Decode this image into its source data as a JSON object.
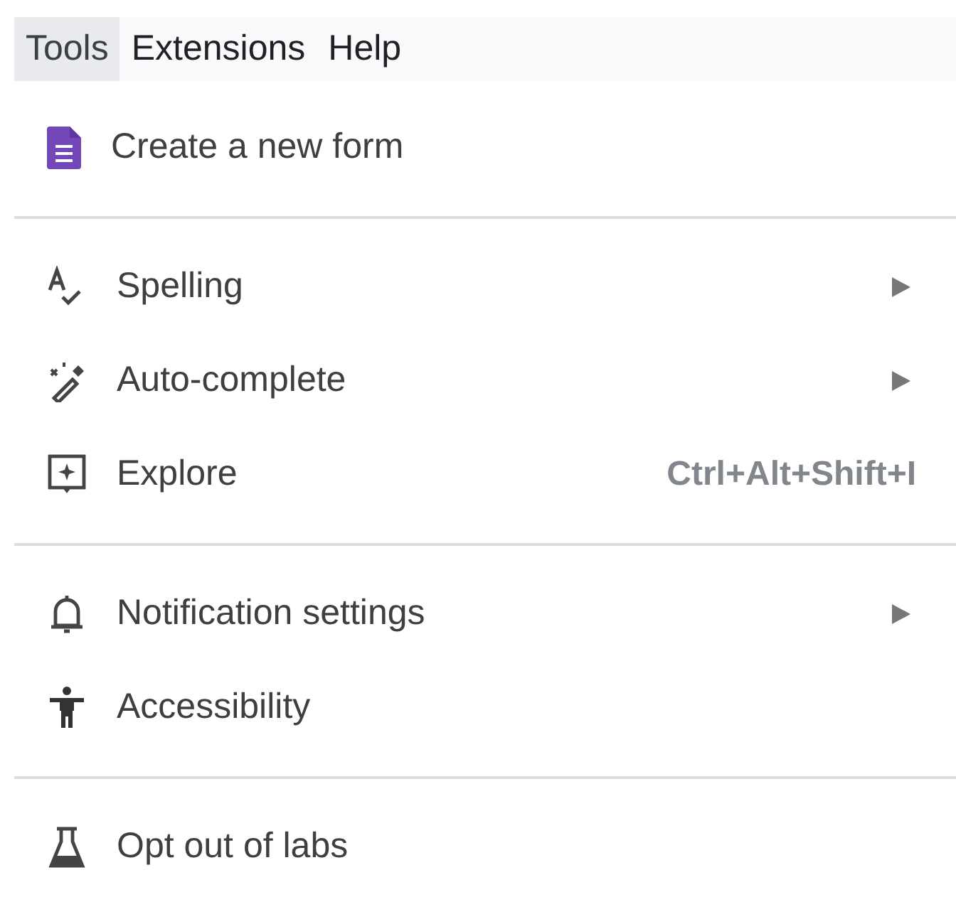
{
  "menubar": [
    {
      "label": "Tools",
      "selected": true
    },
    {
      "label": "Extensions",
      "selected": false
    },
    {
      "label": "Help",
      "selected": false
    }
  ],
  "menu": {
    "sections": [
      {
        "items": [
          {
            "label": "Create a new form",
            "submenu": false
          }
        ]
      },
      {
        "items": [
          {
            "label": "Spelling",
            "submenu": true
          },
          {
            "label": "Auto-complete",
            "submenu": true
          },
          {
            "label": "Explore",
            "submenu": false,
            "shortcut": "Ctrl+Alt+Shift+I"
          }
        ]
      },
      {
        "items": [
          {
            "label": "Notification settings",
            "submenu": true
          },
          {
            "label": "Accessibility",
            "submenu": false
          }
        ]
      },
      {
        "items": [
          {
            "label": "Opt out of labs",
            "submenu": false
          }
        ]
      }
    ]
  }
}
